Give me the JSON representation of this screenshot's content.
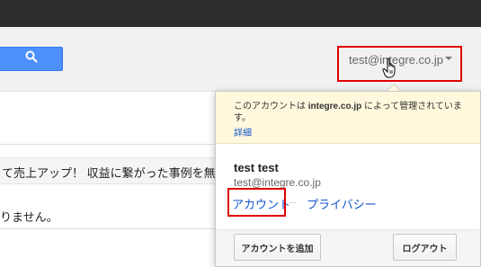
{
  "header": {
    "account_email": "test@integre.co.jp"
  },
  "content": {
    "row1_text": "て売上アップ！ 収益に繋がった事例を無",
    "row2_text": "りません。"
  },
  "popup": {
    "notice_prefix": "このアカウントは ",
    "notice_domain": "integre.co.jp",
    "notice_suffix": " によって管理されています。",
    "details_link": "詳細",
    "user_name": "test test",
    "user_email": "test@integre.co.jp",
    "account_link": "アカウント",
    "separator": "–",
    "privacy_link": "プライバシー",
    "add_account_button": "アカウントを追加",
    "logout_button": "ログアウト"
  },
  "colors": {
    "topbar": "#2d2d2d",
    "search_button": "#4d90fe",
    "highlight_box": "#e00000",
    "notice_bg": "#fff8dd",
    "link": "#1155cc"
  },
  "icons": {
    "search": "search-icon",
    "caret": "chevron-down-icon",
    "cursor": "hand-pointer-icon"
  }
}
